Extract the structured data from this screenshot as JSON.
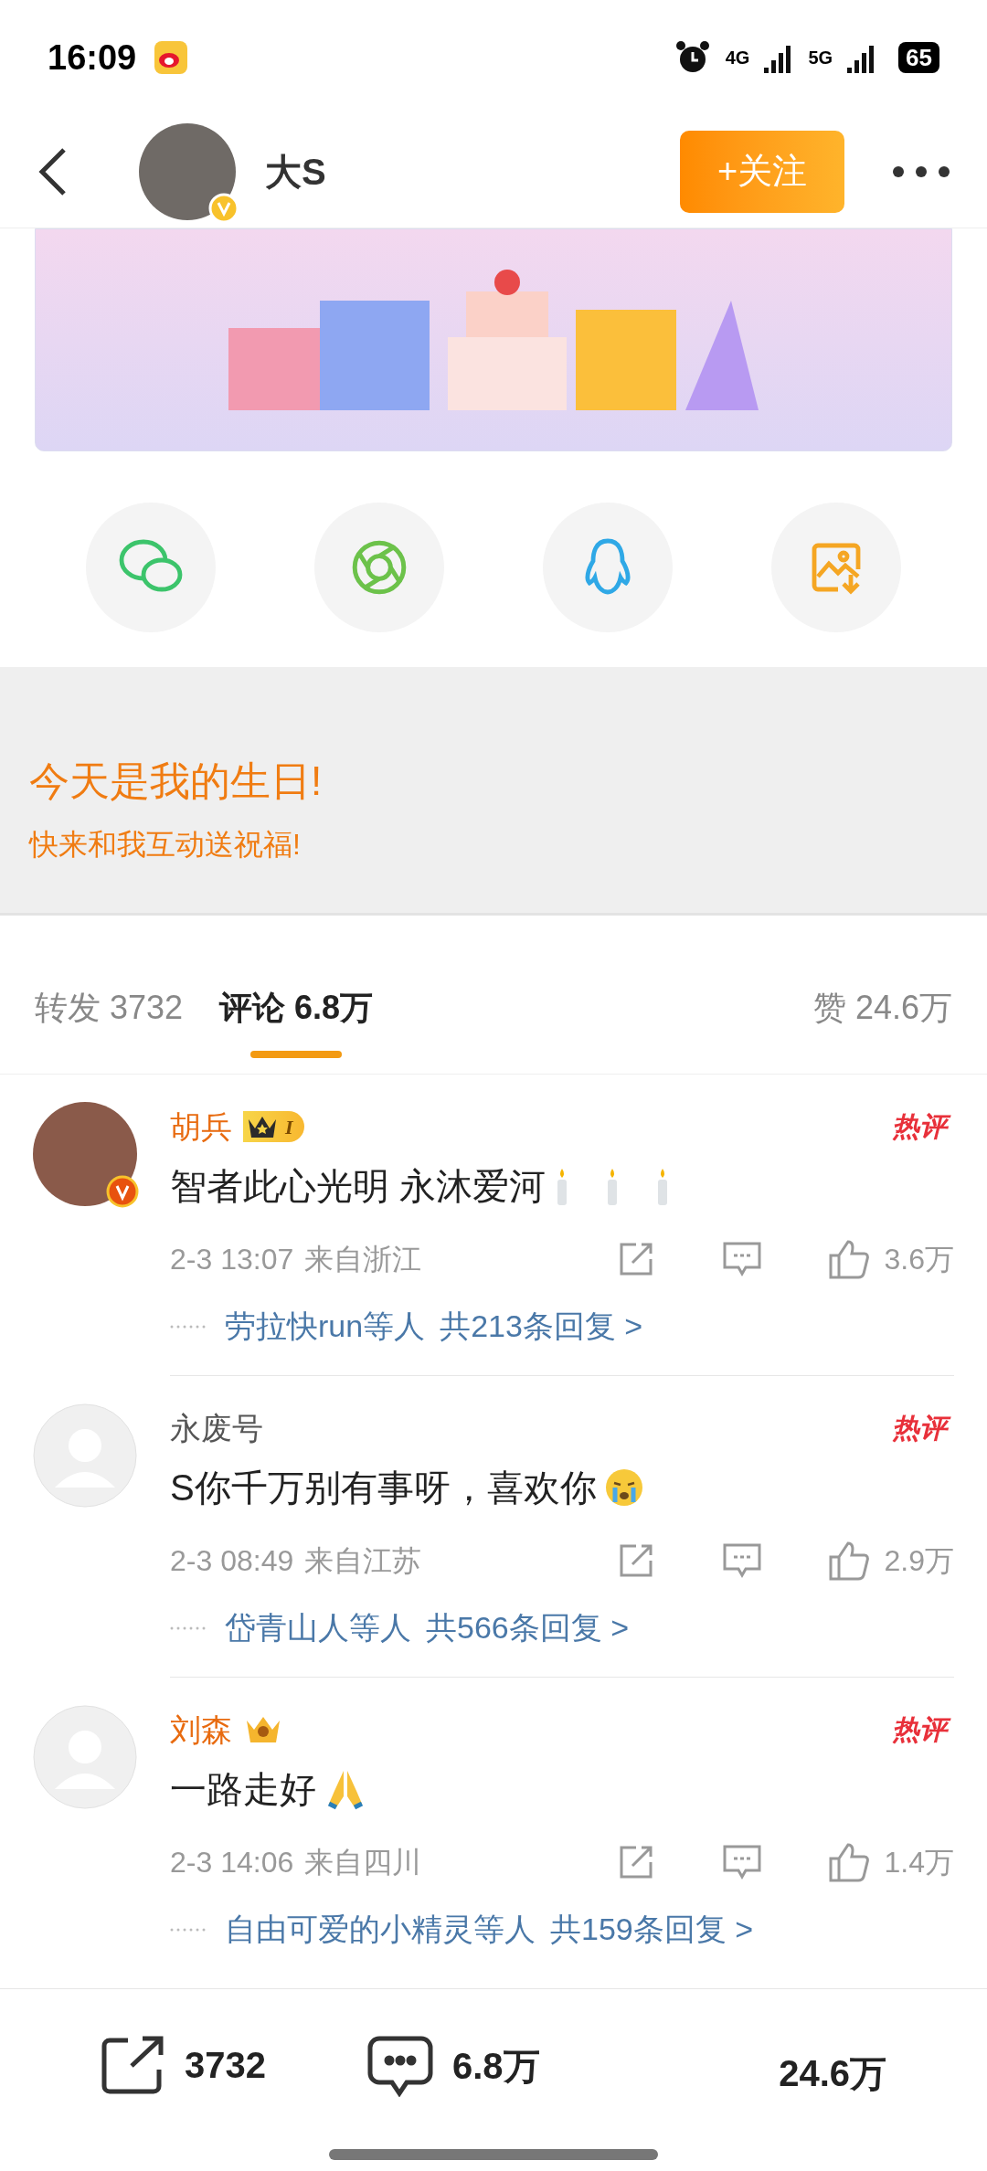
{
  "status_bar": {
    "time": "16:09",
    "network_1": "4G",
    "network_2": "5G",
    "battery": "65"
  },
  "header": {
    "name": "大S",
    "verified": true,
    "follow_button": "+关注"
  },
  "share_targets": [
    {
      "kind": "wechat",
      "color": "#3cc46b"
    },
    {
      "kind": "moments",
      "color": "#6cc24a"
    },
    {
      "kind": "qq",
      "color": "#2fa8e6"
    },
    {
      "kind": "save",
      "color": "#f5a623"
    }
  ],
  "birthday": {
    "title": "今天是我的生日!",
    "subtitle": "快来和我互动送祝福!"
  },
  "tabs": [
    {
      "label": "转发 3732",
      "selected": false
    },
    {
      "label": "评论 6.8万",
      "selected": true
    },
    {
      "label": "赞 24.6万",
      "selected": false
    }
  ],
  "comments": [
    {
      "user": "胡兵",
      "photo": true,
      "verified": true,
      "badge": {
        "kind": "crown_level",
        "label": "I"
      },
      "text": "智者此心光明 永沐爱河",
      "emoji": {
        "kind": "candles"
      },
      "hot": "热评",
      "time": "2-3 13:07",
      "location": "来自浙江",
      "likes": "3.6万",
      "replies": {
        "names": "劳拉快run等人",
        "count": "共213条回复 >"
      }
    },
    {
      "user": "永废号",
      "photo": false,
      "verified": false,
      "text": "S你千万别有事呀，喜欢你",
      "emoji": {
        "kind": "crying"
      },
      "hot": "热评",
      "time": "2-3 08:49",
      "location": "来自江苏",
      "likes": "2.9万",
      "replies": {
        "names": "岱青山人等人",
        "count": "共566条回复 >"
      }
    },
    {
      "user": "刘森",
      "photo": false,
      "verified": false,
      "badge": {
        "kind": "crown"
      },
      "text": "一路走好",
      "emoji": {
        "kind": "pray"
      },
      "hot": "热评",
      "time": "2-3 14:06",
      "location": "来自四川",
      "likes": "1.4万",
      "replies": {
        "names": "自由可爱的小精灵等人",
        "count": "共159条回复 >"
      }
    }
  ],
  "bottom_bar": {
    "reposts": "3732",
    "comments": "6.8万",
    "likes": "24.6万"
  }
}
